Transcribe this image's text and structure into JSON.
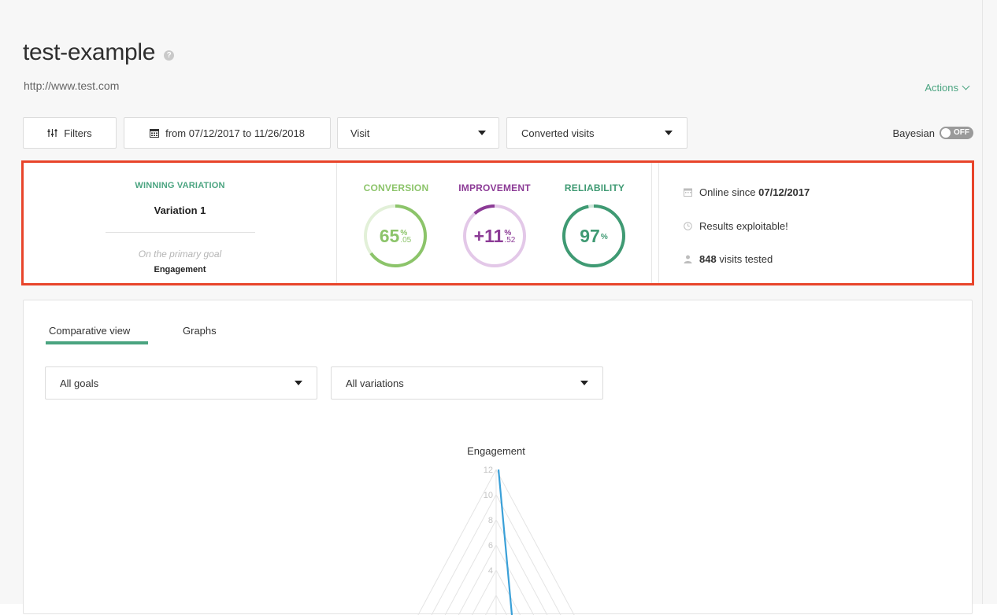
{
  "header": {
    "title": "test-example",
    "help_icon": "?",
    "url": "http://www.test.com",
    "actions_label": "Actions"
  },
  "toolbar": {
    "filters_label": "Filters",
    "date_label": "from 07/12/2017 to 11/26/2018",
    "visit_select": "Visit",
    "converted_select": "Converted visits",
    "bayesian_label": "Bayesian",
    "bayesian_toggle": "OFF"
  },
  "summary": {
    "winning_title": "WINNING VARIATION",
    "winning_name": "Variation 1",
    "goal_label": "On the primary goal",
    "goal_name": "Engagement",
    "conversion": {
      "label": "CONVERSION",
      "whole": "65",
      "unit": "%",
      "decimal": ".05",
      "fraction": 0.6505,
      "color": "#8cc46a"
    },
    "improvement": {
      "label": "IMPROVEMENT",
      "whole": "+11",
      "unit": "%",
      "decimal": ".52",
      "fraction": 0.1152,
      "color": "#8c3b96"
    },
    "reliability": {
      "label": "RELIABILITY",
      "whole": "97",
      "unit": "%",
      "fraction": 0.97,
      "color": "#3f9a73"
    },
    "online_label": "Online since",
    "online_date": "07/12/2017",
    "results_label": "Results exploitable!",
    "visits_count": "848",
    "visits_label": "visits tested"
  },
  "tabs": {
    "comparative": "Comparative view",
    "graphs": "Graphs"
  },
  "selects": {
    "goals": "All goals",
    "variations": "All variations"
  },
  "chart_data": {
    "type": "radar",
    "axes": [
      "Engagement"
    ],
    "ticks": [
      "12",
      "10",
      "8",
      "6",
      "4"
    ],
    "ylim": [
      0,
      12
    ],
    "series": [
      {
        "values": [
          12
        ],
        "color": "#3aa0d8"
      }
    ]
  }
}
